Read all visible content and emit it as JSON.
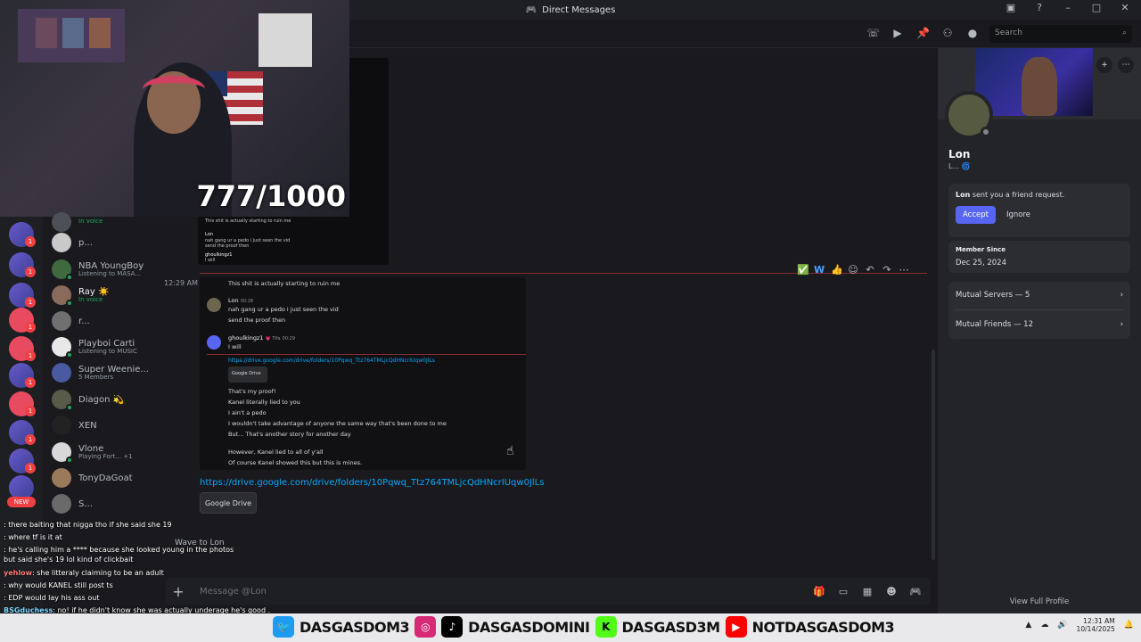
{
  "window": {
    "title": "Direct Messages"
  },
  "header": {
    "search_placeholder": "Search"
  },
  "stream": {
    "counter": "777/1000"
  },
  "dms": [
    {
      "name": "",
      "sub": "In voice"
    },
    {
      "name": "p...",
      "sub": ""
    },
    {
      "name": "NBA YoungBoy",
      "sub": "Listening to MASA..."
    },
    {
      "name": "Ray ☀️",
      "sub": "In voice"
    },
    {
      "name": "r...",
      "sub": ""
    },
    {
      "name": "Playboi Carti",
      "sub": "Listening to MUSIC"
    },
    {
      "name": "Super Weenie...",
      "sub": "5 Members"
    },
    {
      "name": "Diagon 💫",
      "sub": ""
    },
    {
      "name": "XEN",
      "sub": ""
    },
    {
      "name": "Vlone",
      "sub": "Playing Fort... +1"
    },
    {
      "name": "TonyDaGoat",
      "sub": ""
    },
    {
      "name": "S...",
      "sub": ""
    }
  ],
  "rail": {
    "new_label": "NEW"
  },
  "stream_chat": [
    {
      "user": "",
      "text": ": there baiting that nigga tho if she said she 19"
    },
    {
      "user": "",
      "text": ": where tf is it at"
    },
    {
      "user": "",
      "text": ": he's calling him a **** because she looked young in the photos"
    },
    {
      "user": "",
      "text": "but said she's 19 lol kind of clickbait"
    },
    {
      "user": "yehlow",
      "text": ": she litteraly claiming to be an adult"
    },
    {
      "user": "",
      "text": ": why would KANEL still post ts"
    },
    {
      "user": "",
      "text": ": EDP would lay his ass out"
    },
    {
      "user": "BSGduchess",
      "text": ": no! if he didn't know she was actually underage he's good ."
    }
  ],
  "chat": {
    "wave_label": "Wave to Lon",
    "timestamp": "12:29 AM",
    "embed_top_lines": [
      "This shit is actually starting to ruin me",
      "Lon",
      "nah gang ur a pedo i just seen the vid",
      "send the proof then",
      "ghoulkingz1",
      "I will"
    ],
    "screenshot": {
      "line1": "This shit is actually starting to ruin me",
      "lon_name": "Lon",
      "lon_time": "00:28",
      "lon_msg1": "nah gang ur a pedo i just seen the vid",
      "lon_msg2": "send the proof then",
      "g_name": "ghoulkingz1",
      "g_tag": "💗 Tifa",
      "g_time": "00:29",
      "g_msg": "I will",
      "link": "https://drive.google.com/drive/folders/10Pqwq_Ttz764TMLjcQdHNcrIUqw0JlLs",
      "gdrive": "Google Drive",
      "body": [
        "That's my proof!",
        "Kanel literally lied to you",
        "I ain't a pedo",
        "I wouldn't take advantage of anyone the same way that's been done to me",
        "But... That's another story for another day",
        "",
        "However, Kanel lied to all of y'all",
        "Of course Kanel showed this but this is mines."
      ]
    },
    "link": "https://drive.google.com/drive/folders/10Pqwq_Ttz764TMLjcQdHNcrIUqw0JlLs",
    "gdrive_button": "Google Drive",
    "composer_placeholder": "Message @Lon"
  },
  "profile": {
    "name": "Lon",
    "status": "L... 🌀",
    "request_user": "Lon",
    "request_text": " sent you a friend request.",
    "accept": "Accept",
    "ignore": "Ignore",
    "member_since_label": "Member Since",
    "member_since": "Dec 25, 2024",
    "mutual_servers": "Mutual Servers — 5",
    "mutual_friends": "Mutual Friends — 12",
    "view_full": "View Full Profile"
  },
  "socials": {
    "twitter": "DASGASDOM3",
    "tiktok": "DASGASDOMINI",
    "kick": "DASGASD3M",
    "youtube": "NOTDASGASDOM3"
  },
  "taskbar": {
    "time": "12:31 AM",
    "date": "10/14/2025"
  }
}
